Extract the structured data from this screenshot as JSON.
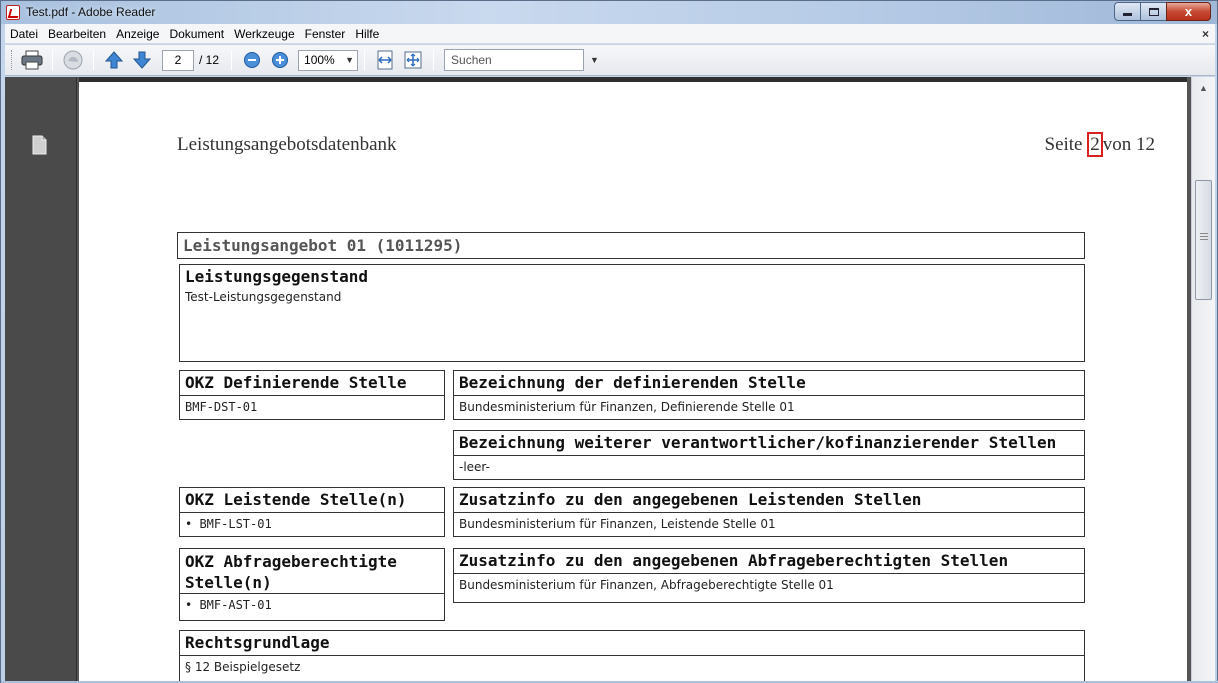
{
  "window": {
    "title": "Test.pdf - Adobe Reader",
    "close_symbol": "x"
  },
  "menu": {
    "items": [
      "Datei",
      "Bearbeiten",
      "Anzeige",
      "Dokument",
      "Werkzeuge",
      "Fenster",
      "Hilfe"
    ],
    "close_symbol": "×"
  },
  "toolbar": {
    "current_page": "2",
    "total_pages": "/ 12",
    "zoom": "100%",
    "search_placeholder": "Suchen",
    "icons": [
      "printer-icon",
      "cloud-share-icon",
      "arrow-up-icon",
      "arrow-down-icon",
      "zoom-out-icon",
      "zoom-in-icon",
      "fit-width-icon",
      "fit-page-icon"
    ]
  },
  "document": {
    "header_left": "Leistungsangebotsdatenbank",
    "header_right_prefix": "Seite",
    "header_right_page": "2",
    "header_right_suffix": "von 12",
    "offer_title": "Leistungsangebot 01 (1011295)",
    "subject_heading": "Leistungsgegenstand",
    "subject_value": "Test-Leistungsgegenstand",
    "okz_def_heading": "OKZ Definierende Stelle",
    "okz_def_value": "BMF-DST-01",
    "def_name_heading": "Bezeichnung der definierenden Stelle",
    "def_name_value": "Bundesministerium für Finanzen, Definierende Stelle 01",
    "other_heading": "Bezeichnung weiterer verantwortlicher/kofinanzierender Stellen",
    "other_value": "-leer-",
    "okz_lst_heading": "OKZ Leistende Stelle(n)",
    "okz_lst_value": "•  BMF-LST-01",
    "lst_info_heading": "Zusatzinfo zu den angegebenen Leistenden Stellen",
    "lst_info_value": "Bundesministerium für Finanzen, Leistende Stelle 01",
    "okz_ast_heading_line1": "OKZ Abfrageberechtigte",
    "okz_ast_heading_line2": "Stelle(n)",
    "okz_ast_value": "•  BMF-AST-01",
    "ast_info_heading": "Zusatzinfo zu den angegebenen Abfrageberechtigten Stellen",
    "ast_info_value": "Bundesministerium für Finanzen, Abfrageberechtigte Stelle 01",
    "legal_heading": "Rechtsgrundlage",
    "legal_value": "§ 12 Beispielgesetz"
  },
  "colors": {
    "highlight_box": "#d82020",
    "nav_pane": "#4a4a4a",
    "title_gray": "#555555"
  }
}
